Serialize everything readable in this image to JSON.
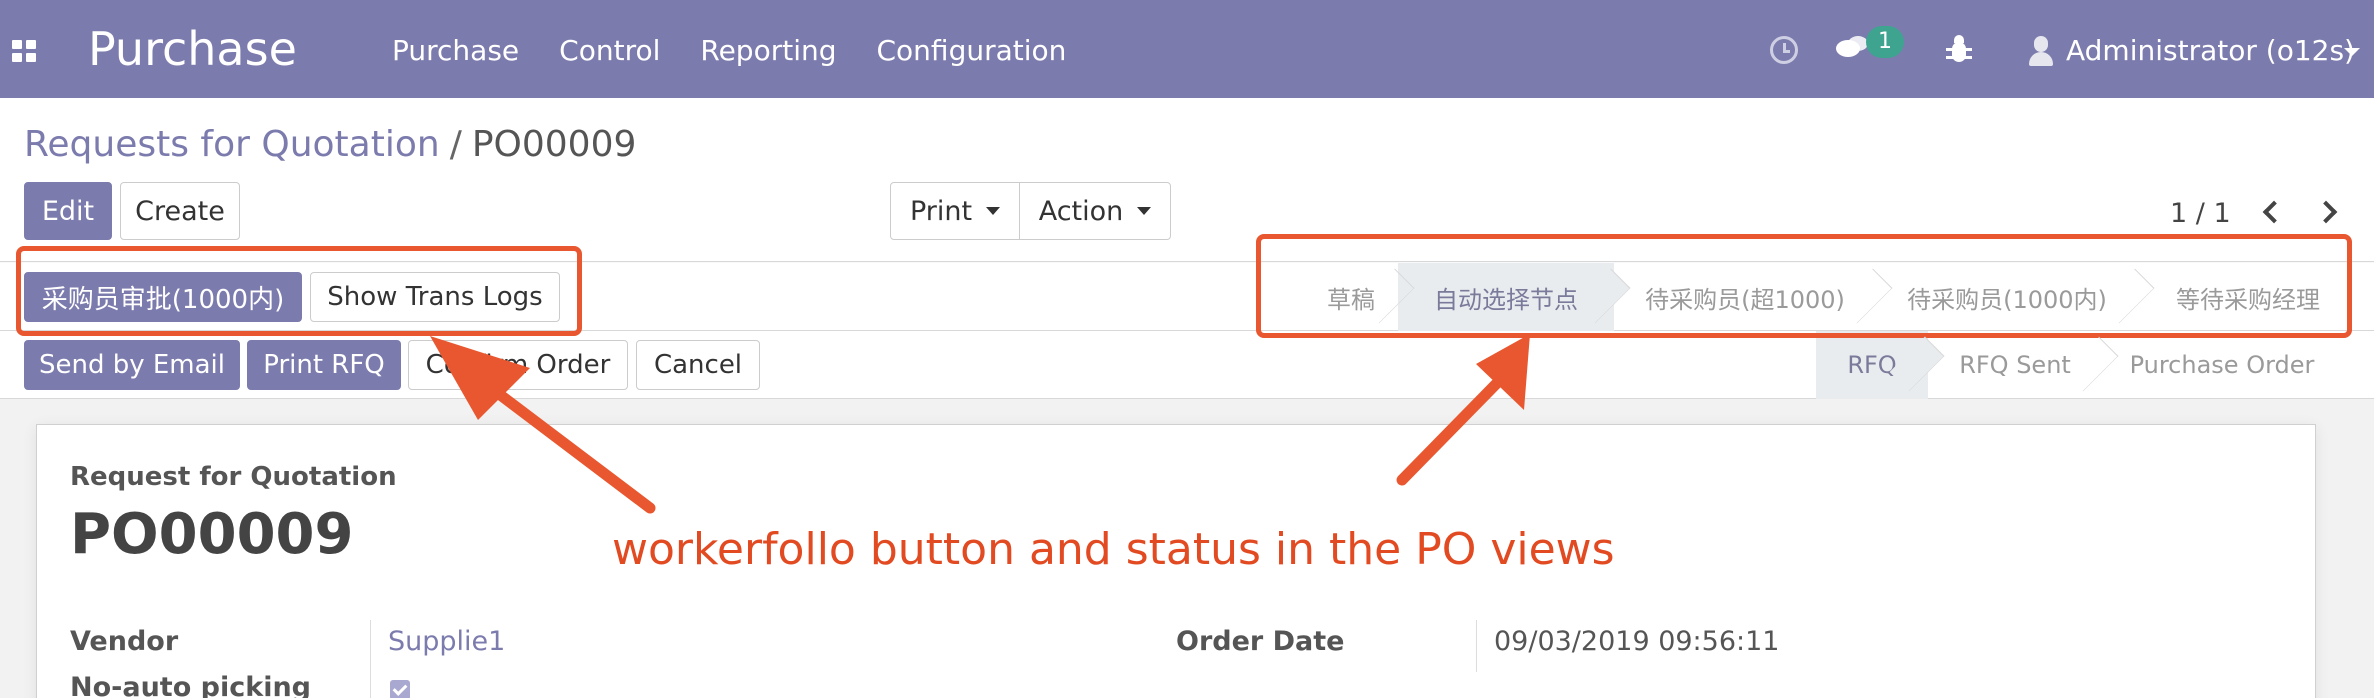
{
  "navbar": {
    "brand": "Purchase",
    "menu": [
      "Purchase",
      "Control",
      "Reporting",
      "Configuration"
    ],
    "message_count": "1",
    "user": "Administrator (o12s)"
  },
  "control": {
    "breadcrumb_parent": "Requests for Quotation",
    "breadcrumb_sep": "/",
    "breadcrumb_current": "PO00009",
    "edit_label": "Edit",
    "create_label": "Create",
    "print_label": "Print",
    "action_label": "Action",
    "pager": "1 / 1"
  },
  "workflow": {
    "approve_label": "采购员审批(1000内)",
    "logs_label": "Show Trans Logs",
    "steps": [
      "草稿",
      "自动选择节点",
      "待采购员(超1000)",
      "待采购员(1000内)",
      "等待采购经理"
    ],
    "active_index": 1
  },
  "po_header": {
    "send_email_label": "Send by Email",
    "print_rfq_label": "Print RFQ",
    "confirm_label": "Confirm Order",
    "cancel_label": "Cancel",
    "states": [
      "RFQ",
      "RFQ Sent",
      "Purchase Order"
    ],
    "active_index": 0
  },
  "sheet": {
    "label": "Request for Quotation",
    "title": "PO00009",
    "vendor_label": "Vendor",
    "vendor_value": "Supplie1",
    "picking_label": "No-auto picking",
    "order_date_label": "Order Date",
    "order_date_value": "09/03/2019 09:56:11"
  },
  "annotation": {
    "text": "workerfollo button and status  in the PO views",
    "color": "#e8572f"
  },
  "colors": {
    "brand": "#7c7bad",
    "badge": "#3ea48f"
  }
}
